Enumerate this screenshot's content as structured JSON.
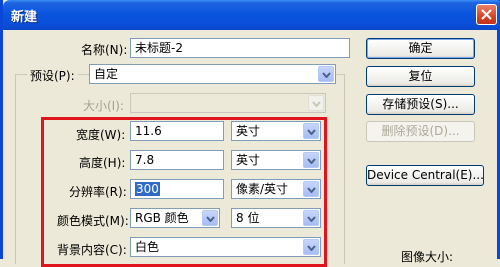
{
  "window": {
    "title": "新建"
  },
  "labels": {
    "name": "名称(N):",
    "preset": "预设(P):",
    "size": "大小(I):",
    "width": "宽度(W):",
    "height": "高度(H):",
    "resolution": "分辨率(R):",
    "color_mode": "颜色模式(M):",
    "background": "背景内容(C):",
    "image_size": "图像大小:"
  },
  "fields": {
    "name_value": "未标题-2",
    "preset_value": "自定",
    "size_value": "",
    "width_value": "11.6",
    "width_unit": "英寸",
    "height_value": "7.8",
    "height_unit": "英寸",
    "resolution_value": "300",
    "resolution_unit": "像素/英寸",
    "color_mode_value": "RGB 颜色",
    "bit_depth": "8 位",
    "background_value": "白色"
  },
  "buttons": {
    "ok": "确定",
    "reset": "复位",
    "save_preset": "存储预设(S)...",
    "delete_preset": "删除预设(D)...",
    "device_central": "Device Central(E)..."
  },
  "colors": {
    "title_bar": "#0a55de",
    "highlight_box": "#e0141c",
    "selection": "#316ac5"
  }
}
